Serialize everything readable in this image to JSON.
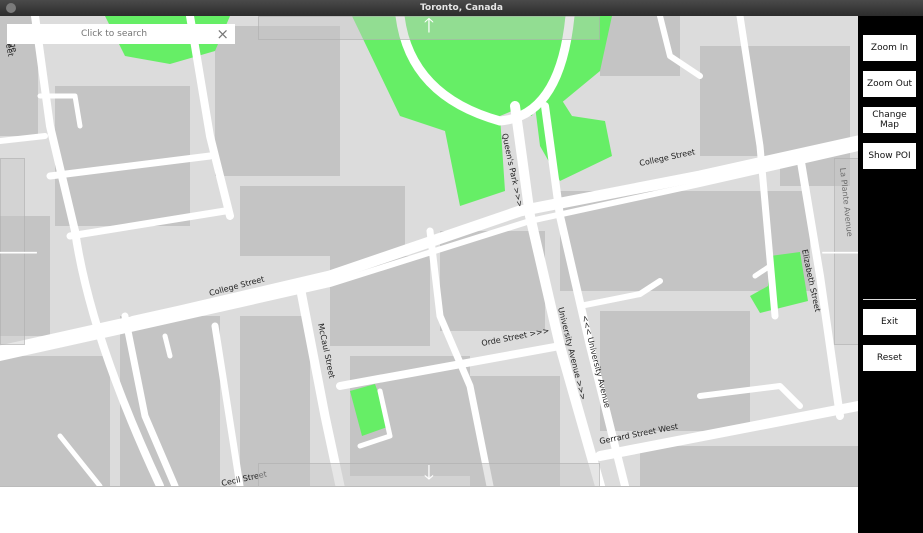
{
  "window": {
    "title": "Toronto, Canada"
  },
  "search": {
    "placeholder": "Click to search",
    "close_icon": "×"
  },
  "nav": {
    "up": "🡑",
    "down": "🡓",
    "left": "🡐",
    "right": "🡒"
  },
  "controls": {
    "zoom_in": "Zoom In",
    "zoom_out": "Zoom Out",
    "change_map": "Change Map",
    "show_poi": "Show POI",
    "exit": "Exit",
    "reset": "Reset"
  },
  "map": {
    "colors": {
      "background": "#dcdcdc",
      "building": "#c4c4c4",
      "road": "#ffffff",
      "park": "#66ee66"
    },
    "street_labels": {
      "college_street_west": "College Street",
      "college_street_east": "College Street",
      "queens_park": "Queen's Park >>>",
      "university_avenue_south": "University Avenue >>>",
      "university_avenue_north": "<<< University Avenue",
      "orde_street": "Orde Street >>>",
      "mccaul_street": "McCaul Street",
      "elizabeth_street": "Elizabeth Street",
      "gerrard_street_west": "Gerrard Street West",
      "cecil_street": "Cecil Street",
      "la_plante_avenue": "La Plante Avenue",
      "left_edge_top": "eorge",
      "left_edge_bottom": "eet"
    }
  }
}
